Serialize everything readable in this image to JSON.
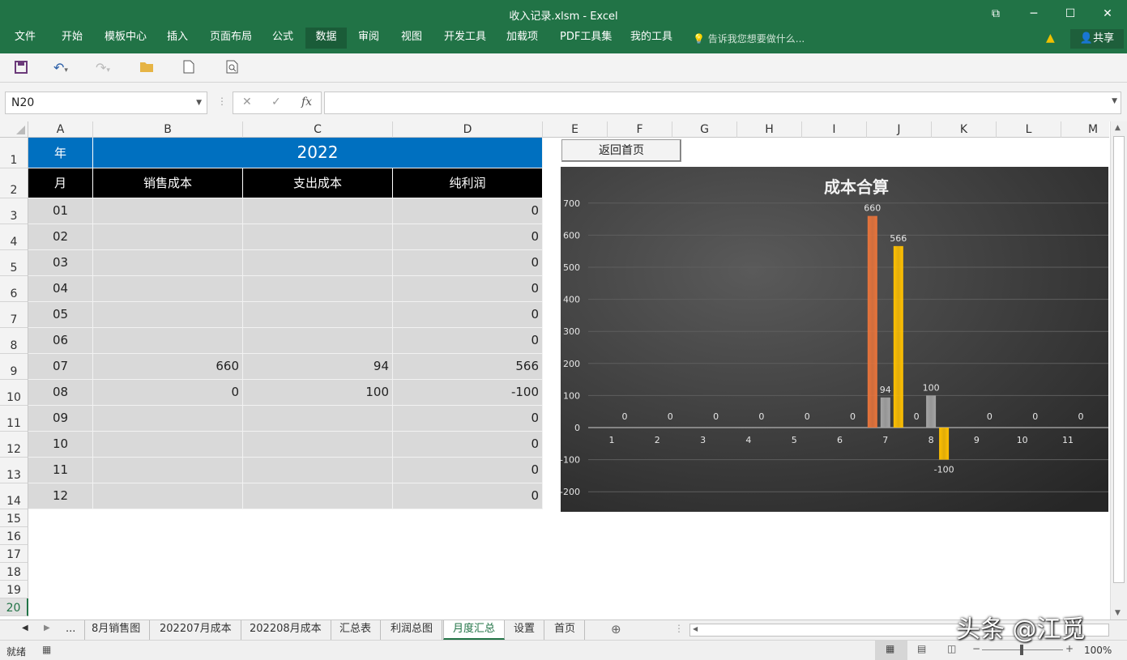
{
  "window": {
    "title": "收入记录.xlsm - Excel"
  },
  "ribbon": {
    "tabs": [
      "文件",
      "开始",
      "模板中心",
      "插入",
      "页面布局",
      "公式",
      "数据",
      "审阅",
      "视图",
      "开发工具",
      "加载项",
      "PDF工具集",
      "我的工具"
    ],
    "active_tab": "数据",
    "tell_me": "告诉我您想要做什么...",
    "share": "共享"
  },
  "formula_bar": {
    "name_box": "N20",
    "fx": "fx",
    "formula": ""
  },
  "columns": [
    "A",
    "B",
    "C",
    "D",
    "E",
    "F",
    "G",
    "H",
    "I",
    "J",
    "K",
    "L",
    "M"
  ],
  "rows": [
    "1",
    "2",
    "3",
    "4",
    "5",
    "6",
    "7",
    "8",
    "9",
    "10",
    "11",
    "12",
    "13",
    "14",
    "15",
    "16",
    "17",
    "18",
    "19",
    "20"
  ],
  "table": {
    "year_label": "年",
    "year": "2022",
    "headers": [
      "月",
      "销售成本",
      "支出成本",
      "纯利润"
    ],
    "data": [
      {
        "month": "01",
        "sales": "",
        "expense": "",
        "profit": "0"
      },
      {
        "month": "02",
        "sales": "",
        "expense": "",
        "profit": "0"
      },
      {
        "month": "03",
        "sales": "",
        "expense": "",
        "profit": "0"
      },
      {
        "month": "04",
        "sales": "",
        "expense": "",
        "profit": "0"
      },
      {
        "month": "05",
        "sales": "",
        "expense": "",
        "profit": "0"
      },
      {
        "month": "06",
        "sales": "",
        "expense": "",
        "profit": "0"
      },
      {
        "month": "07",
        "sales": "660",
        "expense": "94",
        "profit": "566"
      },
      {
        "month": "08",
        "sales": "0",
        "expense": "100",
        "profit": "-100"
      },
      {
        "month": "09",
        "sales": "",
        "expense": "",
        "profit": "0"
      },
      {
        "month": "10",
        "sales": "",
        "expense": "",
        "profit": "0"
      },
      {
        "month": "11",
        "sales": "",
        "expense": "",
        "profit": "0"
      },
      {
        "month": "12",
        "sales": "",
        "expense": "",
        "profit": "0"
      }
    ]
  },
  "home_button": "返回首页",
  "chart_data": {
    "type": "bar",
    "title": "成本合算",
    "categories": [
      "1",
      "2",
      "3",
      "4",
      "5",
      "6",
      "7",
      "8",
      "9",
      "10",
      "11"
    ],
    "ylim": [
      -200,
      700
    ],
    "yticks": [
      "700",
      "600",
      "500",
      "400",
      "300",
      "200",
      "100",
      "0",
      "-100",
      "-200"
    ],
    "series": [
      {
        "values": [
          0,
          0,
          0,
          0,
          0,
          0,
          660,
          0,
          0,
          0,
          0
        ],
        "color": "#e8743b"
      },
      {
        "values": [
          0,
          0,
          0,
          0,
          0,
          0,
          94,
          100,
          0,
          0,
          0
        ],
        "color": "#a5a5a5"
      },
      {
        "values": [
          0,
          0,
          0,
          0,
          0,
          0,
          566,
          -100,
          0,
          0,
          0
        ],
        "color": "#ffc000"
      }
    ],
    "data_labels": [
      {
        "category": "1",
        "text": "0"
      },
      {
        "category": "2",
        "text": "0"
      },
      {
        "category": "3",
        "text": "0"
      },
      {
        "category": "4",
        "text": "0"
      },
      {
        "category": "5",
        "text": "0"
      },
      {
        "category": "6",
        "text": "0"
      },
      {
        "category": "7",
        "text": "660",
        "series": 0
      },
      {
        "category": "7",
        "text": "94",
        "series": 1
      },
      {
        "category": "7",
        "text": "566",
        "series": 2
      },
      {
        "category": "8",
        "text": "0",
        "series": 0
      },
      {
        "category": "8",
        "text": "100",
        "series": 1
      },
      {
        "category": "8",
        "text": "-100",
        "series": 2
      },
      {
        "category": "9",
        "text": "0"
      },
      {
        "category": "10",
        "text": "0"
      },
      {
        "category": "11",
        "text": "0"
      }
    ],
    "grid": true,
    "legend": "none"
  },
  "sheet_tabs": [
    "...",
    "8月销售图",
    "202207月成本",
    "202208月成本",
    "汇总表",
    "利润总图",
    "月度汇总",
    "设置",
    "首页"
  ],
  "active_sheet": "月度汇总",
  "status": {
    "ready": "就绪",
    "zoom": "100%"
  },
  "watermark": "头条 @江觅"
}
